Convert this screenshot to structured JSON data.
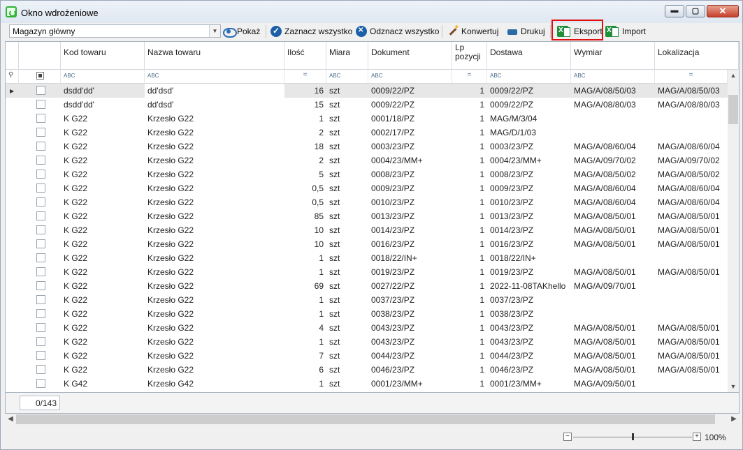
{
  "window": {
    "title": "Okno wdrożeniowe",
    "accent": "#2fb234"
  },
  "toolbar": {
    "warehouse": "Magazyn główny",
    "show": "Pokaż",
    "select_all": "Zaznacz wszystko",
    "deselect_all": "Odznacz wszystko",
    "convert": "Konwertuj",
    "print": "Drukuj",
    "export": "Eksport",
    "import": "Import"
  },
  "grid": {
    "columns": {
      "code": "Kod towaru",
      "name": "Nazwa towaru",
      "qty": "Ilość",
      "unit": "Miara",
      "doc": "Dokument",
      "lp": "Lp pozycji",
      "delivery": "Dostawa",
      "dimension": "Wymiar",
      "location": "Lokalizacja"
    },
    "filter": {
      "text_icon": "ABC",
      "eq_icon": "="
    },
    "rows": [
      {
        "code": "dsdd'dd'",
        "name": "dd'dsd'",
        "qty": "16",
        "unit": "szt",
        "doc": "0009/22/PZ",
        "lp": "1",
        "delivery": "0009/22/PZ",
        "dimension": "MAG/A/08/50/03",
        "location": "MAG/A/08/50/03"
      },
      {
        "code": "dsdd'dd'",
        "name": "dd'dsd'",
        "qty": "15",
        "unit": "szt",
        "doc": "0009/22/PZ",
        "lp": "1",
        "delivery": "0009/22/PZ",
        "dimension": "MAG/A/08/80/03",
        "location": "MAG/A/08/80/03"
      },
      {
        "code": "K G22",
        "name": "Krzesło G22",
        "qty": "1",
        "unit": "szt",
        "doc": "0001/18/PZ",
        "lp": "1",
        "delivery": "MAG/M/3/04",
        "dimension": "",
        "location": ""
      },
      {
        "code": "K G22",
        "name": "Krzesło G22",
        "qty": "2",
        "unit": "szt",
        "doc": "0002/17/PZ",
        "lp": "1",
        "delivery": "MAG/D/1/03",
        "dimension": "",
        "location": ""
      },
      {
        "code": "K G22",
        "name": "Krzesło G22",
        "qty": "18",
        "unit": "szt",
        "doc": "0003/23/PZ",
        "lp": "1",
        "delivery": "0003/23/PZ",
        "dimension": "MAG/A/08/60/04",
        "location": "MAG/A/08/60/04"
      },
      {
        "code": "K G22",
        "name": "Krzesło G22",
        "qty": "2",
        "unit": "szt",
        "doc": "0004/23/MM+",
        "lp": "1",
        "delivery": "0004/23/MM+",
        "dimension": "MAG/A/09/70/02",
        "location": "MAG/A/09/70/02"
      },
      {
        "code": "K G22",
        "name": "Krzesło G22",
        "qty": "5",
        "unit": "szt",
        "doc": "0008/23/PZ",
        "lp": "1",
        "delivery": "0008/23/PZ",
        "dimension": "MAG/A/08/50/02",
        "location": "MAG/A/08/50/02"
      },
      {
        "code": "K G22",
        "name": "Krzesło G22",
        "qty": "0,5",
        "unit": "szt",
        "doc": "0009/23/PZ",
        "lp": "1",
        "delivery": "0009/23/PZ",
        "dimension": "MAG/A/08/60/04",
        "location": "MAG/A/08/60/04"
      },
      {
        "code": "K G22",
        "name": "Krzesło G22",
        "qty": "0,5",
        "unit": "szt",
        "doc": "0010/23/PZ",
        "lp": "1",
        "delivery": "0010/23/PZ",
        "dimension": "MAG/A/08/60/04",
        "location": "MAG/A/08/60/04"
      },
      {
        "code": "K G22",
        "name": "Krzesło G22",
        "qty": "85",
        "unit": "szt",
        "doc": "0013/23/PZ",
        "lp": "1",
        "delivery": "0013/23/PZ",
        "dimension": "MAG/A/08/50/01",
        "location": "MAG/A/08/50/01"
      },
      {
        "code": "K G22",
        "name": "Krzesło G22",
        "qty": "10",
        "unit": "szt",
        "doc": "0014/23/PZ",
        "lp": "1",
        "delivery": "0014/23/PZ",
        "dimension": "MAG/A/08/50/01",
        "location": "MAG/A/08/50/01"
      },
      {
        "code": "K G22",
        "name": "Krzesło G22",
        "qty": "10",
        "unit": "szt",
        "doc": "0016/23/PZ",
        "lp": "1",
        "delivery": "0016/23/PZ",
        "dimension": "MAG/A/08/50/01",
        "location": "MAG/A/08/50/01"
      },
      {
        "code": "K G22",
        "name": "Krzesło G22",
        "qty": "1",
        "unit": "szt",
        "doc": "0018/22/IN+",
        "lp": "1",
        "delivery": "0018/22/IN+",
        "dimension": "",
        "location": ""
      },
      {
        "code": "K G22",
        "name": "Krzesło G22",
        "qty": "1",
        "unit": "szt",
        "doc": "0019/23/PZ",
        "lp": "1",
        "delivery": "0019/23/PZ",
        "dimension": "MAG/A/08/50/01",
        "location": "MAG/A/08/50/01"
      },
      {
        "code": "K G22",
        "name": "Krzesło G22",
        "qty": "69",
        "unit": "szt",
        "doc": "0027/22/PZ",
        "lp": "1",
        "delivery": "2022-11-08TAKhello",
        "dimension": "MAG/A/09/70/01",
        "location": ""
      },
      {
        "code": "K G22",
        "name": "Krzesło G22",
        "qty": "1",
        "unit": "szt",
        "doc": "0037/23/PZ",
        "lp": "1",
        "delivery": "0037/23/PZ",
        "dimension": "",
        "location": ""
      },
      {
        "code": "K G22",
        "name": "Krzesło G22",
        "qty": "1",
        "unit": "szt",
        "doc": "0038/23/PZ",
        "lp": "1",
        "delivery": "0038/23/PZ",
        "dimension": "",
        "location": ""
      },
      {
        "code": "K G22",
        "name": "Krzesło G22",
        "qty": "4",
        "unit": "szt",
        "doc": "0043/23/PZ",
        "lp": "1",
        "delivery": "0043/23/PZ",
        "dimension": "MAG/A/08/50/01",
        "location": "MAG/A/08/50/01"
      },
      {
        "code": "K G22",
        "name": "Krzesło G22",
        "qty": "1",
        "unit": "szt",
        "doc": "0043/23/PZ",
        "lp": "1",
        "delivery": "0043/23/PZ",
        "dimension": "MAG/A/08/50/01",
        "location": "MAG/A/08/50/01"
      },
      {
        "code": "K G22",
        "name": "Krzesło G22",
        "qty": "7",
        "unit": "szt",
        "doc": "0044/23/PZ",
        "lp": "1",
        "delivery": "0044/23/PZ",
        "dimension": "MAG/A/08/50/01",
        "location": "MAG/A/08/50/01"
      },
      {
        "code": "K G22",
        "name": "Krzesło G22",
        "qty": "6",
        "unit": "szt",
        "doc": "0046/23/PZ",
        "lp": "1",
        "delivery": "0046/23/PZ",
        "dimension": "MAG/A/08/50/01",
        "location": "MAG/A/08/50/01"
      },
      {
        "code": "K G42",
        "name": "Krzesło G42",
        "qty": "1",
        "unit": "szt",
        "doc": "0001/23/MM+",
        "lp": "1",
        "delivery": "0001/23/MM+",
        "dimension": "MAG/A/09/50/01",
        "location": ""
      }
    ]
  },
  "footer": {
    "counter": "0/143"
  },
  "zoom": {
    "minus": "−",
    "plus": "+",
    "value": "100%",
    "level": 0.5
  }
}
